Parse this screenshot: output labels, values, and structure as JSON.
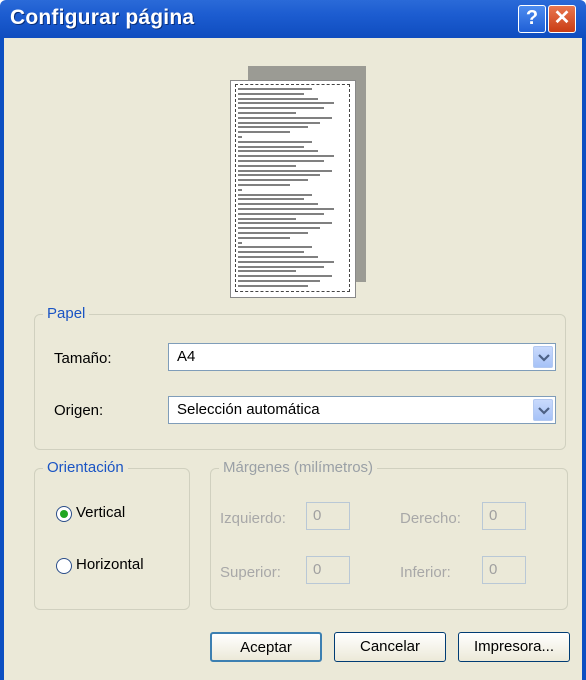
{
  "window": {
    "title": "Configurar página"
  },
  "titlebar": {
    "help_glyph": "?",
    "close_glyph": "✕",
    "help_icon": "help-icon",
    "close_icon": "close-icon"
  },
  "paper_group": {
    "legend": "Papel",
    "size_label": "Tamaño:",
    "size_value": "A4",
    "source_label": "Origen:",
    "source_value": "Selección automática"
  },
  "orientation_group": {
    "legend": "Orientación",
    "vertical_label": "Vertical",
    "horizontal_label": "Horizontal",
    "selected": "Vertical"
  },
  "margins_group": {
    "legend": "Márgenes (milímetros)",
    "left_label": "Izquierdo:",
    "left_value": "0",
    "right_label": "Derecho:",
    "right_value": "0",
    "top_label": "Superior:",
    "top_value": "0",
    "bottom_label": "Inferior:",
    "bottom_value": "0"
  },
  "buttons": {
    "ok": "Aceptar",
    "cancel": "Cancelar",
    "printer": "Impresora..."
  },
  "colors": {
    "titlebar": "#0f4dbf",
    "dialog_bg": "#ebe9d8",
    "legend_active": "#1a54c4",
    "radio_selected": "#21a621"
  }
}
